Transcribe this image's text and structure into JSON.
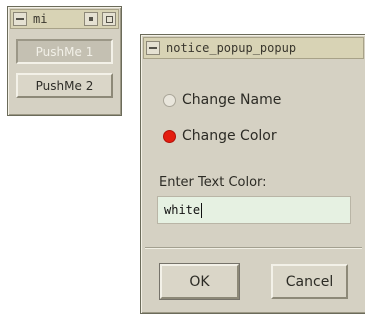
{
  "small_window": {
    "title": "mi",
    "buttons": [
      "PushMe 1",
      "PushMe 2"
    ]
  },
  "dialog": {
    "title": "notice_popup_popup",
    "radio_options": [
      {
        "label": "Change Name",
        "selected": false
      },
      {
        "label": "Change Color",
        "selected": true
      }
    ],
    "text_label": "Enter Text Color:",
    "text_value": "white",
    "ok_label": "OK",
    "cancel_label": "Cancel"
  },
  "colors": {
    "radio_selected": "#e41d10",
    "field_background": "#e6f1e2",
    "window_background": "#d5d1c3"
  }
}
